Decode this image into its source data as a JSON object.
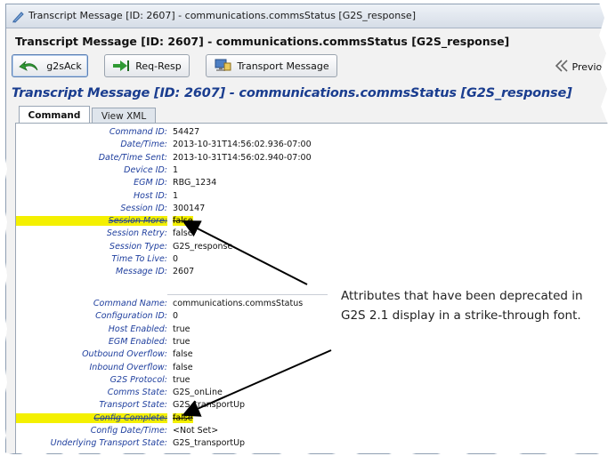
{
  "window": {
    "title": "Transcript Message [ID: 2607] - communications.commsStatus [G2S_response]"
  },
  "header": {
    "title": "Transcript Message [ID: 2607] - communications.commsStatus [G2S_response]"
  },
  "toolbar": {
    "g2sack_label": "g2sAck",
    "reqresp_label": "Req-Resp",
    "transport_label": "Transport Message",
    "previous_label": "Previous"
  },
  "main": {
    "title": "Transcript Message [ID: 2607] - communications.commsStatus [G2S_response]",
    "tabs": [
      {
        "label": "Command"
      },
      {
        "label": "View XML"
      }
    ]
  },
  "fields_group1": [
    {
      "label": "Command ID:",
      "value": "54427"
    },
    {
      "label": "Date/Time:",
      "value": "2013-10-31T14:56:02.936-07:00"
    },
    {
      "label": "Date/Time Sent:",
      "value": "2013-10-31T14:56:02.940-07:00"
    },
    {
      "label": "Device ID:",
      "value": "1"
    },
    {
      "label": "EGM ID:",
      "value": "RBG_1234"
    },
    {
      "label": "Host ID:",
      "value": "1"
    },
    {
      "label": "Session ID:",
      "value": "300147"
    },
    {
      "label": "Session More:",
      "value": "false",
      "deprecated": true
    },
    {
      "label": "Session Retry:",
      "value": "false"
    },
    {
      "label": "Session Type:",
      "value": "G2S_response"
    },
    {
      "label": "Time To Live:",
      "value": "0"
    },
    {
      "label": "Message ID:",
      "value": "2607"
    }
  ],
  "fields_group2": [
    {
      "label": "Command Name:",
      "value": "communications.commsStatus"
    },
    {
      "label": "Configuration ID:",
      "value": "0"
    },
    {
      "label": "Host Enabled:",
      "value": "true"
    },
    {
      "label": "EGM Enabled:",
      "value": "true"
    },
    {
      "label": "Outbound Overflow:",
      "value": "false"
    },
    {
      "label": "Inbound Overflow:",
      "value": "false"
    },
    {
      "label": "G2S Protocol:",
      "value": "true"
    },
    {
      "label": "Comms State:",
      "value": "G2S_onLine"
    },
    {
      "label": "Transport State:",
      "value": "G2S_transportUp"
    },
    {
      "label": "Config Complete:",
      "value": "false",
      "deprecated": true
    },
    {
      "label": "Config Date/Time:",
      "value": "<Not Set>"
    },
    {
      "label": "Underlying Transport State:",
      "value": "G2S_transportUp"
    }
  ],
  "callout": {
    "text": "Attributes that have been deprecated in G2S 2.1 display in a strike-through font."
  },
  "colors": {
    "label_blue": "#1f3f9e",
    "title_blue": "#1a3d8f",
    "highlight": "#f4f000"
  }
}
